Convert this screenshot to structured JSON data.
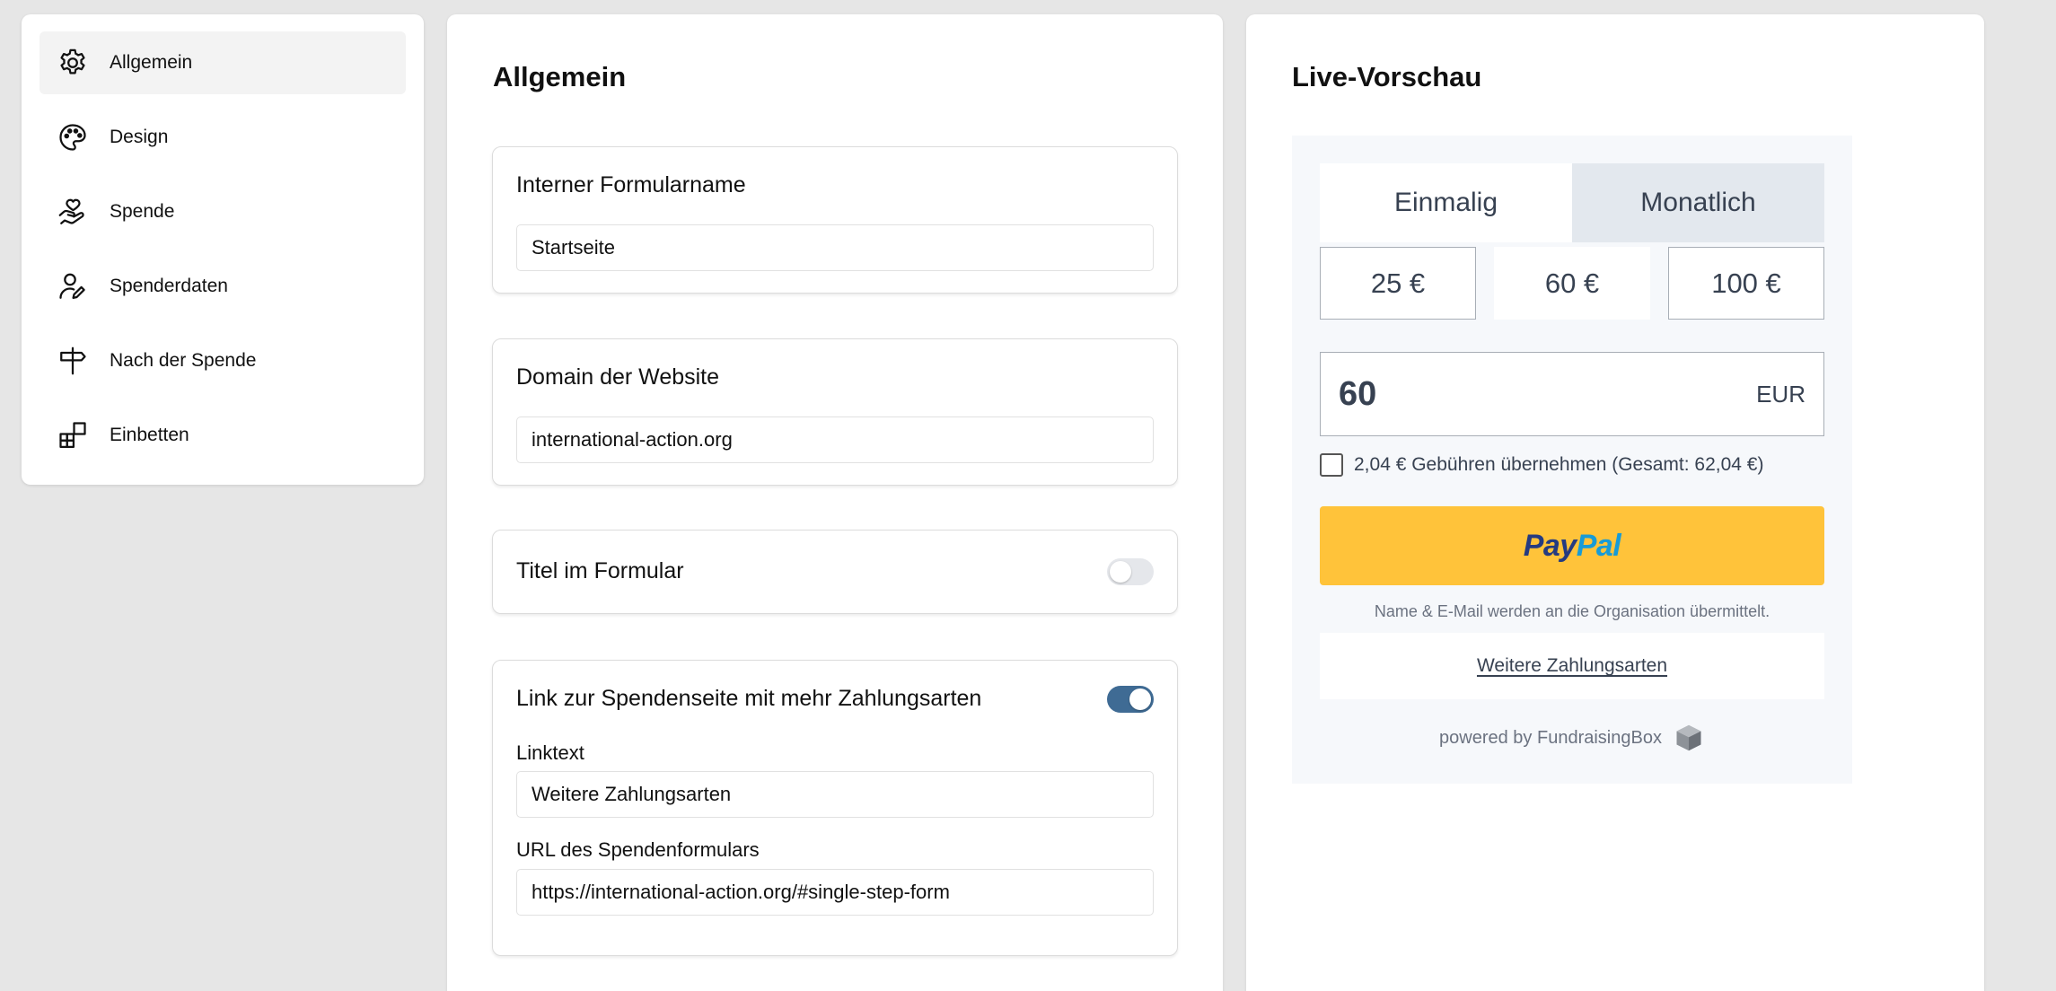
{
  "sidebar": {
    "items": [
      {
        "label": "Allgemein",
        "icon": "gear-icon",
        "active": true
      },
      {
        "label": "Design",
        "icon": "palette-icon",
        "active": false
      },
      {
        "label": "Spende",
        "icon": "hand-heart-icon",
        "active": false
      },
      {
        "label": "Spenderdaten",
        "icon": "user-edit-icon",
        "active": false
      },
      {
        "label": "Nach der Spende",
        "icon": "signpost-icon",
        "active": false
      },
      {
        "label": "Einbetten",
        "icon": "widgets-icon",
        "active": false
      }
    ]
  },
  "general": {
    "title": "Allgemein",
    "form_name": {
      "label": "Interner Formularname",
      "value": "Startseite"
    },
    "domain": {
      "label": "Domain der Website",
      "value": "international-action.org"
    },
    "form_title": {
      "label": "Titel im Formular",
      "enabled": false
    },
    "link": {
      "label": "Link zur Spendenseite mit mehr Zahlungsarten",
      "enabled": true,
      "linktext_label": "Linktext",
      "linktext_value": "Weitere Zahlungsarten",
      "url_label": "URL des Spendenformulars",
      "url_value": "https://international-action.org/#single-step-form"
    }
  },
  "preview": {
    "title": "Live-Vorschau",
    "tabs": [
      {
        "label": "Einmalig",
        "active": true
      },
      {
        "label": "Monatlich",
        "active": false
      }
    ],
    "amounts": [
      "25 €",
      "60 €",
      "100 €"
    ],
    "selected_amount": "60 €",
    "amount_value": "60",
    "currency": "EUR",
    "fee_text": "2,04 € Gebühren übernehmen (Gesamt: 62,04 €)",
    "paypal": {
      "part1": "Pay",
      "part2": "Pal"
    },
    "privacy_note": "Name & E-Mail werden an die Organisation übermittelt.",
    "more_payments": "Weitere Zahlungsarten",
    "powered_by": "powered by FundraisingBox"
  },
  "colors": {
    "toggle_on": "#3f6b94",
    "paypal_yellow": "#ffc33a",
    "paypal_dark_blue": "#253b80",
    "paypal_light_blue": "#179bd7"
  }
}
